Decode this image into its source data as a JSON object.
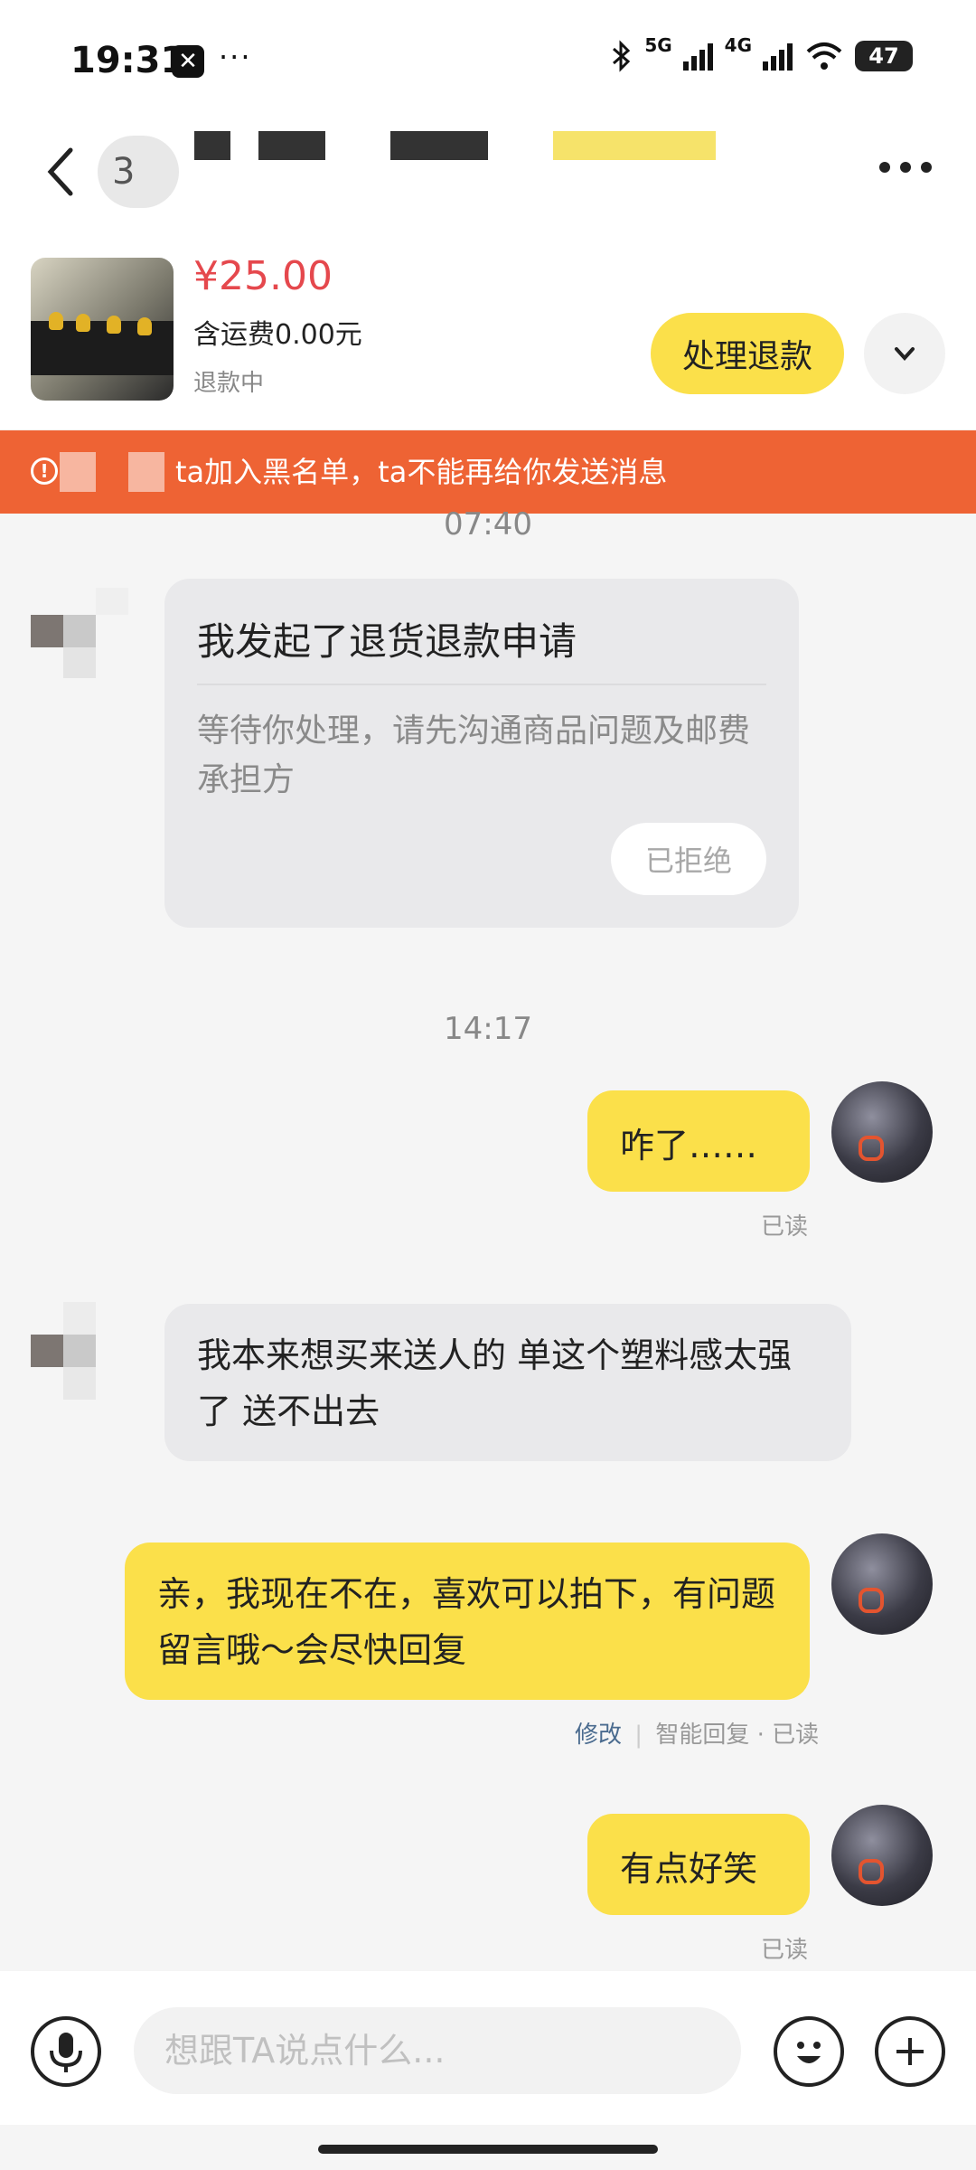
{
  "status_bar": {
    "time": "19:31",
    "notif_glyph": "✕",
    "more_dots": "···",
    "network_5g": "5G",
    "network_4g": "4G",
    "battery": "47"
  },
  "header": {
    "contact_initial": "3"
  },
  "product": {
    "price": "¥25.00",
    "shipping": "含运费0.00元",
    "status": "退款中",
    "refund_button": "处理退款"
  },
  "banner": {
    "text": "ta加入黑名单，ta不能再给你发送消息"
  },
  "chat": {
    "timestamp_1": "07:40",
    "refund_card": {
      "title": "我发起了退货退款申请",
      "description": "等待你处理，请先沟通商品问题及邮费承担方",
      "state": "已拒绝"
    },
    "timestamp_2": "14:17",
    "msg_1": "咋了……",
    "msg_1_read": "已读",
    "msg_2": "我本来想买来送人的 单这个塑料感太强了 送不出去",
    "msg_3": "亲，我现在不在，喜欢可以拍下，有问题留言哦～会尽快回复",
    "msg_3_edit": "修改",
    "msg_3_meta": "智能回复 · 已读",
    "msg_4": "有点好笑",
    "msg_4_read": "已读"
  },
  "input_bar": {
    "placeholder": "想跟TA说点什么..."
  }
}
